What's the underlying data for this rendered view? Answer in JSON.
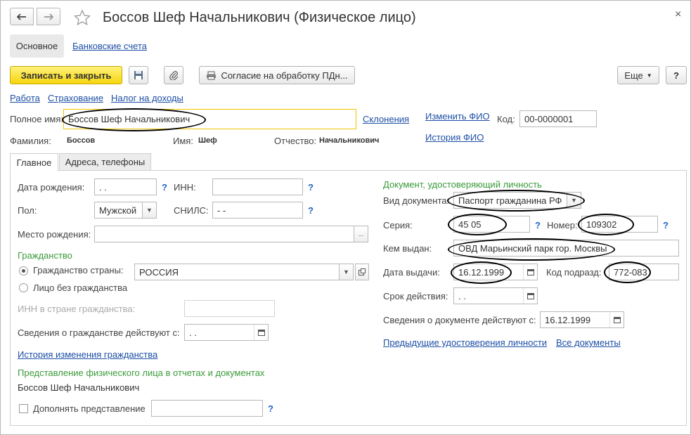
{
  "window": {
    "title": "Боссов Шеф Начальникович (Физическое лицо)",
    "nav_back_icon": "arrow-left-icon",
    "nav_forward_icon": "arrow-right-icon",
    "close_symbol": "×"
  },
  "top_tabs": {
    "main": "Основное",
    "bank": "Банковские счета"
  },
  "toolbar": {
    "save_close": "Записать и закрыть",
    "consent": "Согласие на обработку ПДн...",
    "more": "Еще",
    "help": "?"
  },
  "sections": {
    "work": "Работа",
    "insurance": "Страхование",
    "tax": "Налог на доходы"
  },
  "header": {
    "full_name_label": "Полное имя:",
    "full_name": "Боссов Шеф Начальникович",
    "declension": "Склонения",
    "change_fio": "Изменить ФИО",
    "fio_history": "История ФИО",
    "code_label": "Код:",
    "code": "00-0000001",
    "surname_label": "Фамилия:",
    "surname": "Боссов",
    "name_label": "Имя:",
    "name": "Шеф",
    "patronymic_label": "Отчество:",
    "patronymic": "Начальникович"
  },
  "tabs": {
    "main": "Главное",
    "addresses": "Адреса, телефоны"
  },
  "left": {
    "birth_date_label": "Дата рождения:",
    "birth_date": " .  . ",
    "inn_label": "ИНН:",
    "inn": "",
    "gender_label": "Пол:",
    "gender": "Мужской",
    "snils_label": "СНИЛС:",
    "snils": " -  - ",
    "birth_place_label": "Место рождения:",
    "birth_place": "",
    "citizenship_title": "Гражданство",
    "citizen_of_label": "Гражданство страны:",
    "citizen_of": "РОССИЯ",
    "stateless_label": "Лицо без гражданства",
    "foreign_inn_label": "ИНН в стране гражданства:",
    "citizenship_valid_label": "Сведения о гражданстве действуют с:",
    "citizenship_valid": " .  . ",
    "citizenship_history": "История изменения гражданства",
    "representation_title": "Представление физического лица в отчетах и документах",
    "representation": "Боссов Шеф Начальникович",
    "add_representation_label": "Дополнять представление",
    "question": "?"
  },
  "right": {
    "doc_title": "Документ, удостоверяющий личность",
    "doc_type_label": "Вид документа:",
    "doc_type": "Паспорт гражданина РФ",
    "series_label": "Серия:",
    "series": "45 05",
    "number_label": "Номер:",
    "number": "109302",
    "issued_by_label": "Кем выдан:",
    "issued_by": "ОВД Марьинский парк гор. Москвы",
    "issue_date_label": "Дата выдачи:",
    "issue_date": "16.12.1999",
    "dept_code_label": "Код подразд:",
    "dept_code": "772-083",
    "validity_label": "Срок действия:",
    "validity": " .  . ",
    "doc_valid_label": "Сведения о документе действуют с:",
    "doc_valid": "16.12.1999",
    "prev_docs": "Предыдущие удостоверения личности",
    "all_docs": "Все документы"
  }
}
